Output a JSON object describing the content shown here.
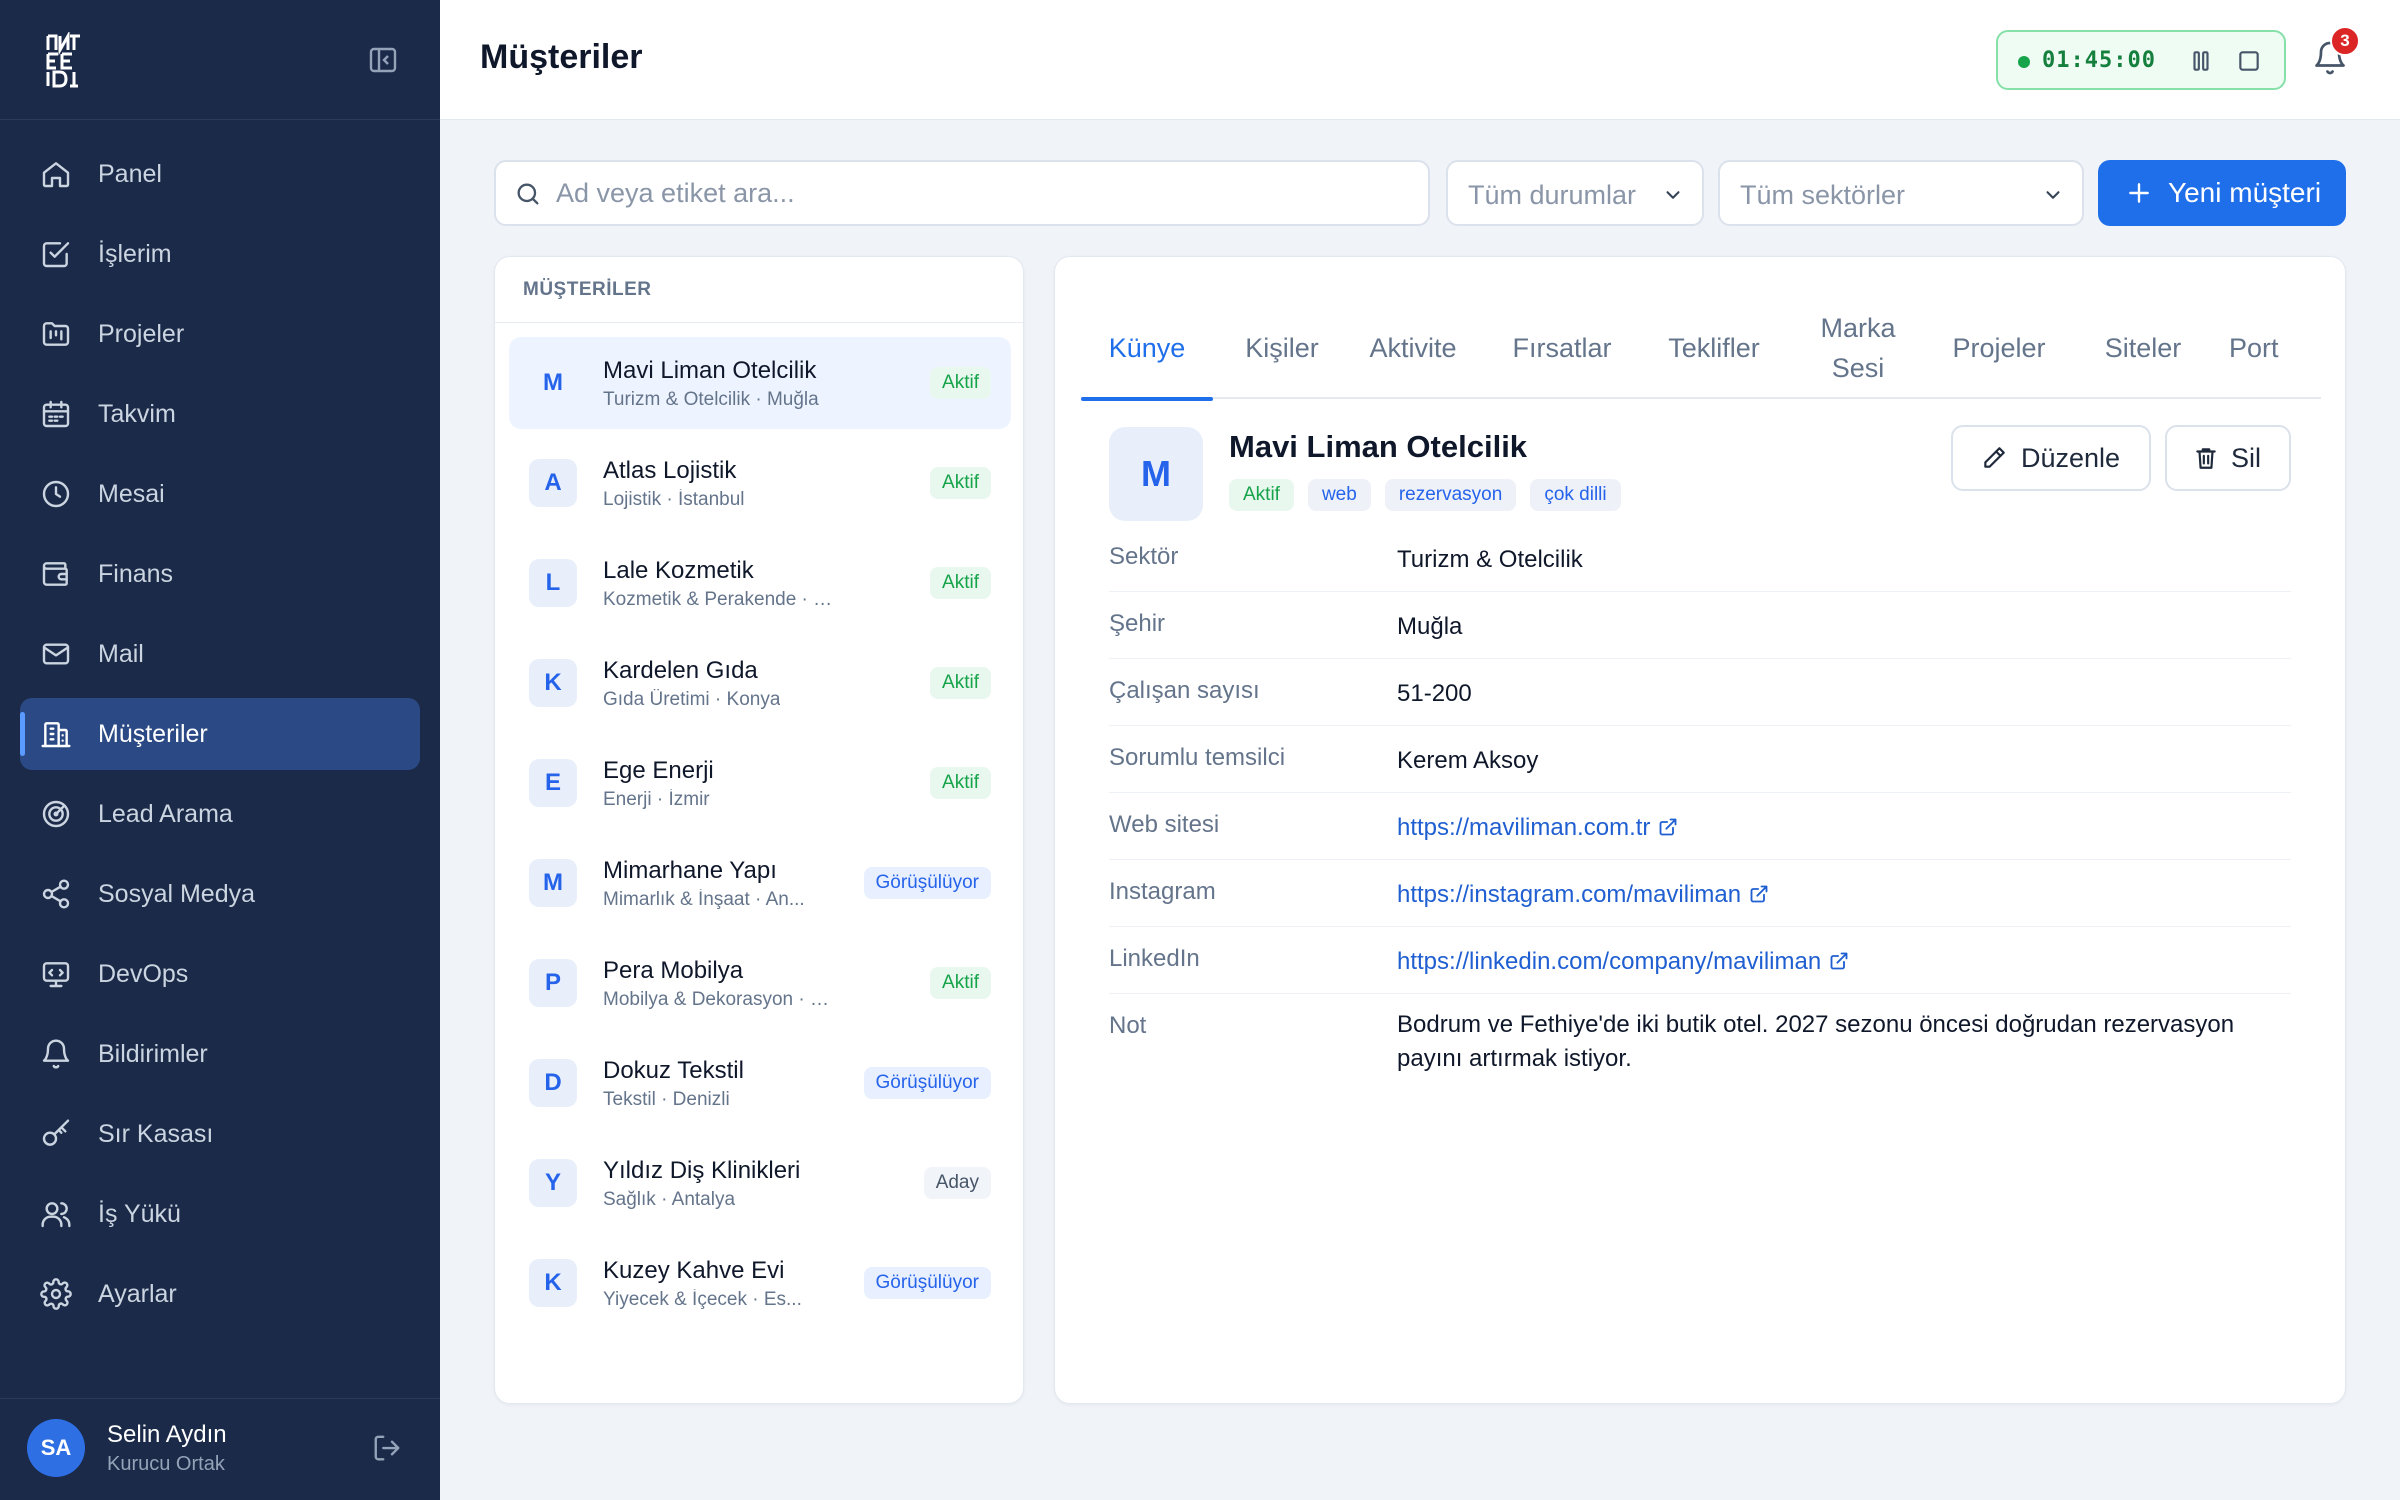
{
  "app": {
    "logo_text": "INFE DI"
  },
  "sidebar": {
    "items": [
      {
        "label": "Panel",
        "icon": "home-icon"
      },
      {
        "label": "İşlerim",
        "icon": "check-square-icon"
      },
      {
        "label": "Projeler",
        "icon": "folder-kanban-icon"
      },
      {
        "label": "Takvim",
        "icon": "calendar-icon"
      },
      {
        "label": "Mesai",
        "icon": "clock-icon"
      },
      {
        "label": "Finans",
        "icon": "wallet-icon"
      },
      {
        "label": "Mail",
        "icon": "mail-icon"
      },
      {
        "label": "Müşteriler",
        "icon": "building-icon",
        "active": true
      },
      {
        "label": "Lead Arama",
        "icon": "radar-icon"
      },
      {
        "label": "Sosyal Medya",
        "icon": "share-icon"
      },
      {
        "label": "DevOps",
        "icon": "monitor-code-icon"
      },
      {
        "label": "Bildirimler",
        "icon": "bell-icon"
      },
      {
        "label": "Sır Kasası",
        "icon": "key-icon"
      },
      {
        "label": "İş Yükü",
        "icon": "users-icon"
      },
      {
        "label": "Ayarlar",
        "icon": "gear-icon"
      }
    ],
    "user": {
      "initials": "SA",
      "name": "Selin Aydın",
      "role": "Kurucu Ortak"
    }
  },
  "header": {
    "title": "Müşteriler",
    "timer": "01:45:00",
    "notification_count": "3"
  },
  "filters": {
    "search_placeholder": "Ad veya etiket ara...",
    "status_select": "Tüm durumlar",
    "sector_select": "Tüm sektörler",
    "new_button": "Yeni müşteri"
  },
  "list": {
    "heading": "MÜŞTERİLER",
    "customers": [
      {
        "initial": "M",
        "name": "Mavi Liman Otelcilik",
        "sub": "Turizm & Otelcilik · Muğla",
        "status": "Aktif",
        "status_kind": "aktif",
        "selected": true
      },
      {
        "initial": "A",
        "name": "Atlas Lojistik",
        "sub": "Lojistik · İstanbul",
        "status": "Aktif",
        "status_kind": "aktif"
      },
      {
        "initial": "L",
        "name": "Lale Kozmetik",
        "sub": "Kozmetik & Perakende · İzmir",
        "status": "Aktif",
        "status_kind": "aktif"
      },
      {
        "initial": "K",
        "name": "Kardelen Gıda",
        "sub": "Gıda Üretimi · Konya",
        "status": "Aktif",
        "status_kind": "aktif"
      },
      {
        "initial": "E",
        "name": "Ege Enerji",
        "sub": "Enerji · İzmir",
        "status": "Aktif",
        "status_kind": "aktif"
      },
      {
        "initial": "M",
        "name": "Mimarhane Yapı",
        "sub": "Mimarlık & İnşaat · An...",
        "status": "Görüşülüyor",
        "status_kind": "gorus"
      },
      {
        "initial": "P",
        "name": "Pera Mobilya",
        "sub": "Mobilya & Dekorasyon · Bursa",
        "status": "Aktif",
        "status_kind": "aktif"
      },
      {
        "initial": "D",
        "name": "Dokuz Tekstil",
        "sub": "Tekstil · Denizli",
        "status": "Görüşülüyor",
        "status_kind": "gorus"
      },
      {
        "initial": "Y",
        "name": "Yıldız Diş Klinikleri",
        "sub": "Sağlık · Antalya",
        "status": "Aday",
        "status_kind": "aday"
      },
      {
        "initial": "K",
        "name": "Kuzey Kahve Evi",
        "sub": "Yiyecek & İçecek · Es...",
        "status": "Görüşülüyor",
        "status_kind": "gorus"
      }
    ]
  },
  "detail": {
    "tabs": [
      {
        "label": "Künye",
        "active": true
      },
      {
        "label": "Kişiler"
      },
      {
        "label": "Aktivite"
      },
      {
        "label": "Fırsatlar"
      },
      {
        "label": "Teklifler"
      },
      {
        "label": "Marka\nSesi"
      },
      {
        "label": "Projeler"
      },
      {
        "label": "Siteler"
      },
      {
        "label": "Port"
      }
    ],
    "initial": "M",
    "name": "Mavi Liman Otelcilik",
    "tags": [
      {
        "label": "Aktif",
        "kind": "green"
      },
      {
        "label": "web"
      },
      {
        "label": "rezervasyon"
      },
      {
        "label": "çok dilli"
      }
    ],
    "edit_button": "Düzenle",
    "delete_button": "Sil",
    "fields": [
      {
        "label": "Sektör",
        "value": "Turizm & Otelcilik"
      },
      {
        "label": "Şehir",
        "value": "Muğla"
      },
      {
        "label": "Çalışan sayısı",
        "value": "51-200"
      },
      {
        "label": "Sorumlu temsilci",
        "value": "Kerem Aksoy"
      },
      {
        "label": "Web sitesi",
        "value": "https://maviliman.com.tr",
        "link": true
      },
      {
        "label": "Instagram",
        "value": "https://instagram.com/maviliman",
        "link": true
      },
      {
        "label": "LinkedIn",
        "value": "https://linkedin.com/company/maviliman",
        "link": true
      },
      {
        "label": "Not",
        "value": "Bodrum ve Fethiye'de iki butik otel. 2027 sezonu öncesi doğrudan rezervasyon payını artırmak istiyor."
      }
    ]
  },
  "colors": {
    "sidebar_bg": "#1b2a48",
    "accent": "#1f6feb",
    "active_green": "#16a34a"
  }
}
